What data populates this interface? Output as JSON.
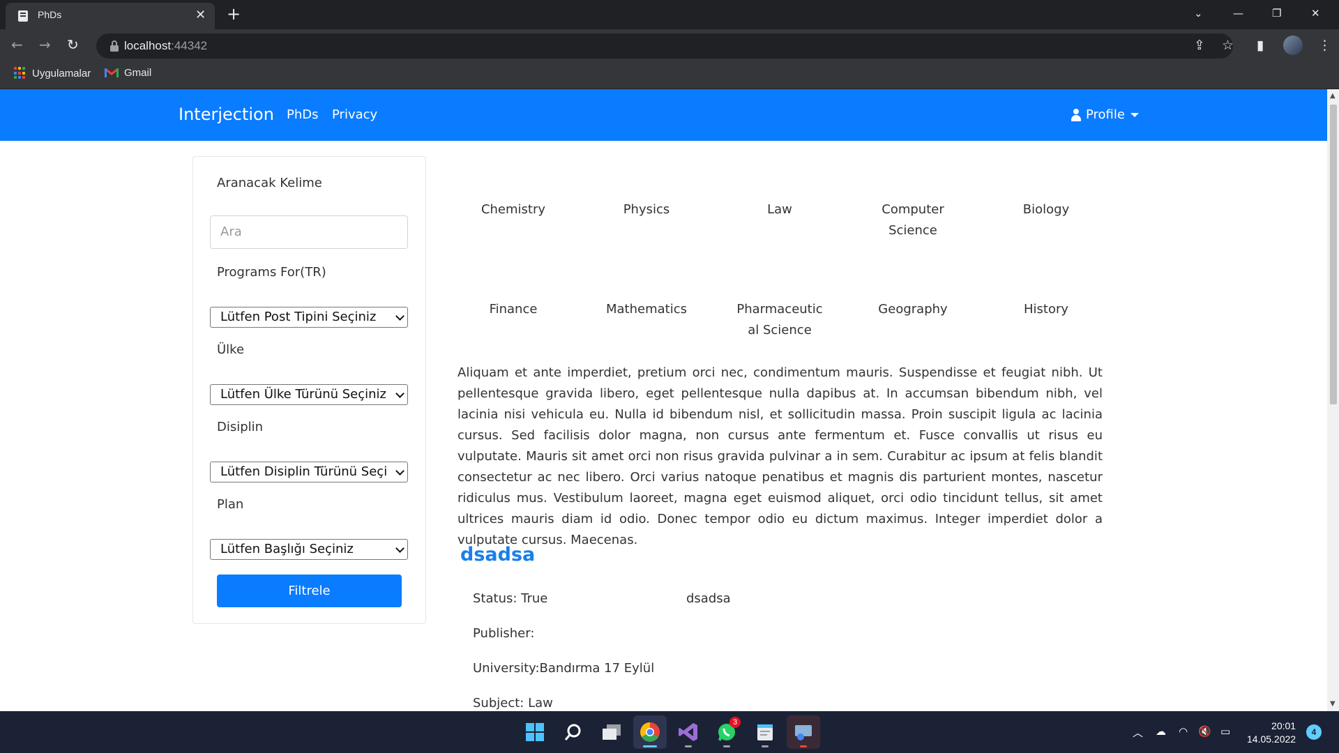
{
  "browser": {
    "tab_title": "PhDs",
    "tab_close": "✕",
    "new_tab": "+",
    "url_host": "localhost",
    "url_port": ":44342",
    "bookmarks": [
      {
        "label": "Uygulamalar",
        "icon": "apps-grid-icon"
      },
      {
        "label": "Gmail",
        "icon": "gmail-icon"
      }
    ]
  },
  "site": {
    "brand": "Interjection",
    "nav": [
      "PhDs",
      "Privacy"
    ],
    "profile": "Profile",
    "accent": "#0a7cff"
  },
  "filters": {
    "search_label": "Aranacak Kelime",
    "search_placeholder": "Ara",
    "programs_label": "Programs For(TR)",
    "programs_value": "Lütfen Post Tipini Seçiniz",
    "country_label": "Ülke",
    "country_value": "Lütfen Ülke Türünü Seçiniz",
    "discipline_label": "Disiplin",
    "discipline_value": "Lütfen Disiplin Türünü Seçi",
    "plan_label": "Plan",
    "plan_value": "Lütfen Başlığı Seçiniz",
    "submit": "Filtrele"
  },
  "categories": [
    [
      "Chemistry",
      "Physics",
      "Law",
      "Computer Science",
      "Biology"
    ],
    [
      "Finance",
      "Mathematics",
      "Pharmaceutical Science",
      "Geography",
      "History"
    ]
  ],
  "description": "Aliquam et ante imperdiet, pretium orci nec, condimentum mauris. Suspendisse et feugiat nibh. Ut pellentesque gravida libero, eget pellentesque nulla dapibus at. In accumsan bibendum nibh, vel lacinia nisi vehicula eu. Nulla id bibendum nisl, et sollicitudin massa. Proin suscipit ligula ac lacinia cursus. Sed facilisis dolor magna, non cursus ante fermentum et. Fusce convallis ut risus eu vulputate. Mauris sit amet orci non risus gravida pulvinar a in sem. Curabitur ac ipsum at felis blandit consectetur ac nec libero. Orci varius natoque penatibus et magnis dis parturient montes, nascetur ridiculus mus. Vestibulum laoreet, magna eget euismod aliquet, orci odio tincidunt tellus, sit amet ultrices mauris diam id odio. Donec tempor odio eu dictum maximus. Integer imperdiet dolor a vulputate cursus. Maecenas.",
  "post": {
    "title": "dsadsa",
    "status": "Status: True",
    "side_text": "dsadsa",
    "publisher": "Publisher:",
    "university": "University:Bandırma 17 Eylül",
    "subject": "Subject: Law"
  },
  "taskbar": {
    "whatsapp_badge": "3",
    "time": "20:01",
    "date": "14.05.2022",
    "notifications": "4"
  }
}
